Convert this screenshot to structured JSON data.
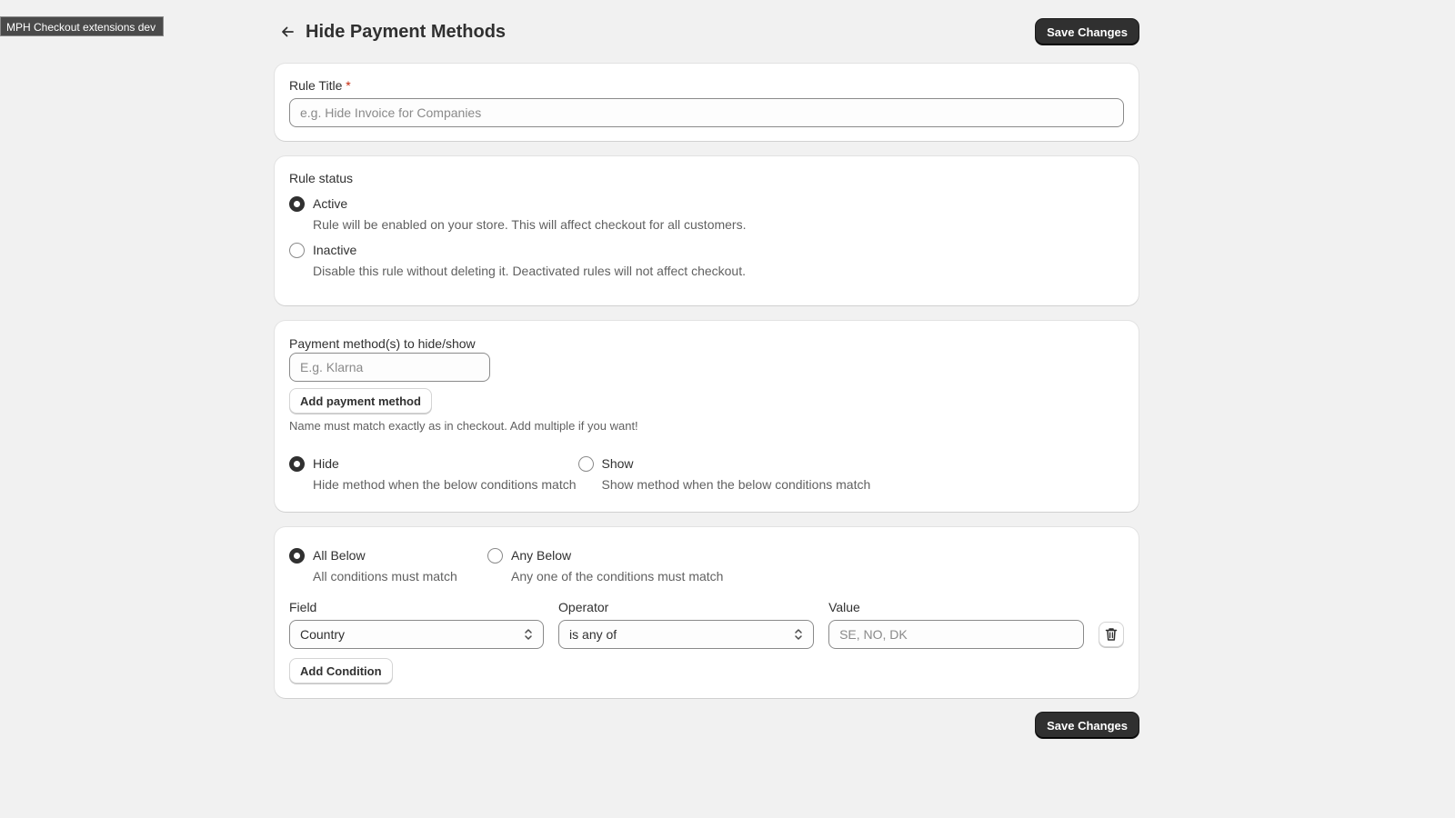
{
  "app": {
    "dev_badge": "MPH Checkout extensions dev"
  },
  "header": {
    "title": "Hide Payment Methods",
    "save_label": "Save Changes"
  },
  "rule_title": {
    "label": "Rule Title",
    "required_mark": "*",
    "placeholder": "e.g. Hide Invoice for Companies",
    "value": ""
  },
  "rule_status": {
    "label": "Rule status",
    "options": [
      {
        "label": "Active",
        "help": "Rule will be enabled on your store. This will affect checkout for all customers.",
        "checked": true
      },
      {
        "label": "Inactive",
        "help": "Disable this rule without deleting it. Deactivated rules will not affect checkout.",
        "checked": false
      }
    ]
  },
  "payment_methods": {
    "label": "Payment method(s) to hide/show",
    "placeholder": "E.g. Klarna",
    "add_label": "Add payment method",
    "help": "Name must match exactly as in checkout. Add multiple if you want!",
    "modes": [
      {
        "label": "Hide",
        "help": "Hide method when the below conditions match",
        "checked": true
      },
      {
        "label": "Show",
        "help": "Show method when the below conditions match",
        "checked": false
      }
    ]
  },
  "conditions": {
    "match": [
      {
        "label": "All Below",
        "help": "All conditions must match",
        "checked": true
      },
      {
        "label": "Any Below",
        "help": "Any one of the conditions must match",
        "checked": false
      }
    ],
    "field_label": "Field",
    "operator_label": "Operator",
    "value_label": "Value",
    "row": {
      "field": "Country",
      "operator": "is any of",
      "value_placeholder": "SE, NO, DK"
    },
    "add_label": "Add Condition"
  },
  "footer": {
    "save_label": "Save Changes"
  },
  "icons": {
    "back": "arrow-left-icon",
    "select": "chevron-up-down-icon",
    "delete": "trash-icon"
  }
}
